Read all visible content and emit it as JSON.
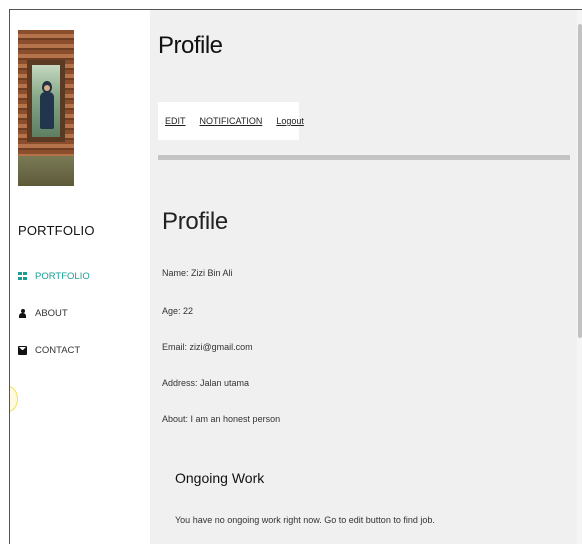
{
  "sidebar": {
    "brand": "PORTFOLIO",
    "items": [
      {
        "label": "PORTFOLIO",
        "icon": "grid-icon",
        "active": true
      },
      {
        "label": "ABOUT",
        "icon": "user-icon",
        "active": false
      },
      {
        "label": "CONTACT",
        "icon": "envelope-icon",
        "active": false
      }
    ]
  },
  "header": {
    "title": "Profile"
  },
  "toolbar": {
    "edit": "EDIT",
    "notification": "NOTIFICATION",
    "logout": "Logout"
  },
  "profile": {
    "title": "Profile",
    "name": "Name: Zizi Bin Ali",
    "age": "Age: 22",
    "email": "Email: zizi@gmail.com",
    "address": "Address: Jalan utama",
    "about": "About: I am an honest person"
  },
  "ongoing": {
    "title": "Ongoing Work",
    "message": "You have no ongoing work right now. Go to edit button to find job."
  },
  "colors": {
    "accent": "#1a9e93",
    "main_bg": "#f0f0f0",
    "divider": "#c4c4c4"
  }
}
